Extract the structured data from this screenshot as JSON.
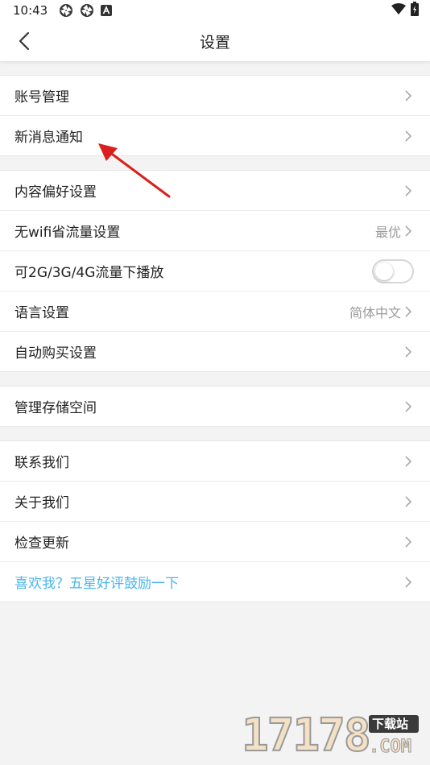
{
  "status_bar": {
    "time": "10:43",
    "icons": [
      "aperture-icon",
      "aperture-icon",
      "a-badge-icon"
    ],
    "right_icons": [
      "wifi-icon",
      "battery-icon"
    ]
  },
  "header": {
    "title": "设置"
  },
  "groups": [
    {
      "items": [
        {
          "label": "账号管理"
        },
        {
          "label": "新消息通知"
        }
      ]
    },
    {
      "items": [
        {
          "label": "内容偏好设置"
        },
        {
          "label": "无wifi省流量设置",
          "value": "最优"
        },
        {
          "label": "可2G/3G/4G流量下播放",
          "toggle": false
        },
        {
          "label": "语言设置",
          "value": "简体中文"
        },
        {
          "label": "自动购买设置"
        }
      ]
    },
    {
      "items": [
        {
          "label": "管理存储空间"
        }
      ]
    },
    {
      "items": [
        {
          "label": "联系我们"
        },
        {
          "label": "关于我们"
        },
        {
          "label": "检查更新"
        },
        {
          "label": "喜欢我？五星好评鼓励一下"
        }
      ]
    }
  ],
  "watermark": {
    "number": "17178",
    "tag": "下载站",
    "suffix": ".COM"
  },
  "colors": {
    "accent": "#4ab6ec",
    "annotation_arrow": "#d9201c"
  }
}
